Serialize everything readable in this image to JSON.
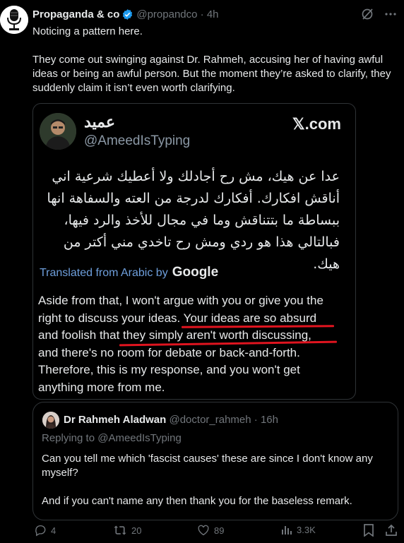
{
  "post": {
    "author_name": "Propaganda & co",
    "author_handle": "@propandco",
    "time": "4h",
    "paragraph1": "Noticing a pattern here.",
    "paragraph2": "They come out swinging against Dr. Rahmeh, accusing her of having awful ideas or being an awful person. But the moment they’re asked to clarify, they suddenly claim it isn’t even worth clarifying."
  },
  "image": {
    "name": "عميد",
    "handle": "@AmeedIsTyping",
    "brand": "𝕏.com",
    "arabic_lines": [
      "عدا عن هيك، مش رح أجادلك ولا أعطيك شرعية اني",
      "أناقش افكارك. أفكارك لدرجة من العته والسفاهة انها",
      "ببساطة ما بتتناقش وما في مجال للأخذ والرد فيها،",
      "فبالتالي هذا هو ردي ومش رح تاخدي مني أكتر من هيك."
    ],
    "translated_label": "Translated from Arabic by",
    "google": "Google",
    "english_lines": [
      "Aside from that, I won't argue with you or give you the",
      "right to discuss your ideas. Your ideas are so absurd",
      "and foolish that they simply aren't worth discussing,",
      "and there's no room for debate or back-and-forth.",
      "Therefore, this is my response, and you won't get",
      "anything more from me."
    ]
  },
  "quoted": {
    "author_name": "Dr Rahmeh Aladwan",
    "author_handle": "@doctor_rahmeh",
    "time": "16h",
    "replying": "Replying to @AmeedIsTyping",
    "paragraph1": "Can you tell me which 'fascist causes' these are since I don't know any myself?",
    "paragraph2": "And if you can't name any then thank you for the baseless remark."
  },
  "actions": {
    "replies": "4",
    "reposts": "20",
    "likes": "89",
    "views": "3.3K"
  },
  "colors": {
    "underline": "#e0141f",
    "verified": "#1d9bf0",
    "muted": "#71767b"
  }
}
